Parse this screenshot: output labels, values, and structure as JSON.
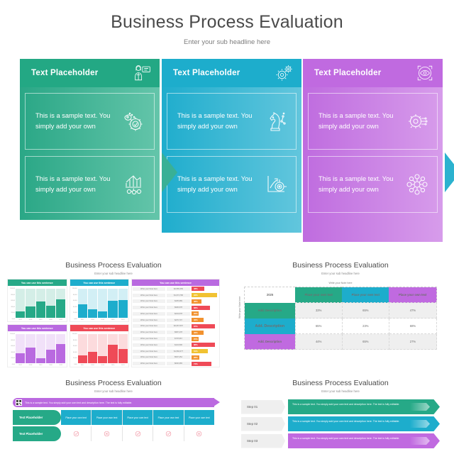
{
  "hero": {
    "title": "Business Process Evaluation",
    "subtitle": "Enter your sub headline here",
    "colors": {
      "green": "#23a884",
      "blue": "#1dadcc",
      "purple": "#c06ae0"
    },
    "panels": [
      {
        "header_label": "Text Placeholder",
        "header_icon": "presenter-icon",
        "cells": [
          {
            "text": "This is a sample text. You simply add your own",
            "icon": "rocket-gear-icon"
          },
          {
            "text": "This is a sample text. You simply add your own",
            "icon": "bar-chart-network-icon"
          }
        ]
      },
      {
        "header_label": "Text Placeholder",
        "header_icon": "gears-icon",
        "cells": [
          {
            "text": "This is a sample text. You simply add your own",
            "icon": "chess-knight-icon"
          },
          {
            "text": "This is a sample text. You simply add your own",
            "icon": "target-growth-icon"
          }
        ]
      },
      {
        "header_label": "Text Placeholder",
        "header_icon": "eye-vision-icon",
        "cells": [
          {
            "text": "This is a sample text. You simply add your own",
            "icon": "gear-circuit-icon"
          },
          {
            "text": "This is a sample text. You simply add your own",
            "icon": "network-nodes-icon"
          }
        ]
      }
    ]
  },
  "thumbs": [
    {
      "id": "charts-and-list",
      "title": "Business Process Evaluation",
      "subtitle": "Enter your sub headline here",
      "charts": [
        {
          "header": "You can use this sentence",
          "color": "#26a987"
        },
        {
          "header": "You can use this sentence",
          "color": "#1dadcc"
        },
        {
          "header": "You can use this sentence",
          "color": "#b96ae0"
        },
        {
          "header": "You can use this sentence",
          "color": "#ef4a57"
        }
      ],
      "list": {
        "header": "You can use this sentence",
        "rows": [
          {
            "note": "Write your Note here",
            "value": "$2,565,456",
            "pct": "48%"
          },
          {
            "note": "Write your Note here",
            "value": "$1,674,786",
            "pct": "94%"
          },
          {
            "note": "Write your Note here",
            "value": "$435,989",
            "pct": "38%"
          },
          {
            "note": "Write your Note here",
            "value": "$906,678",
            "pct": "68%"
          },
          {
            "note": "Write your Note here",
            "value": "$234,678",
            "pct": "26%"
          },
          {
            "note": "Write your Note here",
            "value": "$276,707",
            "pct": "46%"
          },
          {
            "note": "Write your Note here",
            "value": "$2,067,567",
            "pct": "87%"
          },
          {
            "note": "Write your Note here",
            "value": "$987,478",
            "pct": "46%"
          },
          {
            "note": "Write your Note here",
            "value": "$778,967",
            "pct": "25%"
          },
          {
            "note": "Write your Note here",
            "value": "$143,596",
            "pct": "88%"
          },
          {
            "note": "Write your Note here",
            "value": "$1,566,677",
            "pct": "61%"
          },
          {
            "note": "Write your Note here",
            "value": "$597,454",
            "pct": "28%"
          },
          {
            "note": "Write your Note here",
            "value": "$646,365",
            "pct": "74%"
          }
        ]
      }
    },
    {
      "id": "matrix-table",
      "title": "Business Process Evaluation",
      "subtitle": "Enter your sub headline here",
      "top_note": "Write your Note here",
      "side_note": "Write your Note here",
      "year": "2025",
      "columns": [
        "Place your own text",
        "Place your own text",
        "Place your own text"
      ],
      "rows": [
        {
          "label": "Add. Description",
          "color": "#26a987",
          "values": [
            "33%",
            "65%",
            "47%"
          ]
        },
        {
          "label": "Add. Description",
          "color": "#1dadcc",
          "values": [
            "65%",
            "23%",
            "68%"
          ]
        },
        {
          "label": "Add. Description",
          "color": "#c06ae0",
          "values": [
            "44%",
            "65%",
            "27%"
          ]
        }
      ]
    },
    {
      "id": "checklist-grid",
      "title": "Business Process Evaluation",
      "subtitle": "Enter your sub headline here",
      "banner": "This is a sample text. You simply add your own text and description here. The text is fully editable.",
      "banner_icon": "qr-code-icon",
      "rows": [
        {
          "label": "Text Placeholder",
          "cells": [
            "Place your own text",
            "Place your own text",
            "Place your own text",
            "Place your own text",
            "Place your own text"
          ],
          "type": "header"
        },
        {
          "label": "Text Placeholder",
          "cells": [
            "check-icon",
            "cross-icon",
            "check-icon",
            "check-icon",
            "cross-icon"
          ],
          "type": "icons"
        }
      ]
    },
    {
      "id": "steps-arrows",
      "title": "Business Process Evaluation",
      "subtitle": "Enter your sub headline here",
      "steps": [
        {
          "step": "Step 01",
          "text": "This is a sample text. You simply add your own text and description here. The text is fully editable.",
          "color": "#26a987"
        },
        {
          "step": "Step 02",
          "text": "This is a sample text. You simply add your own text and description here. The text is fully editable.",
          "color": "#1dadcc"
        },
        {
          "step": "Step 03",
          "text": "This is a sample text. You simply add your own text and description here. The text is fully editable.",
          "color": "#c06ae0"
        }
      ]
    }
  ],
  "chart_data": [
    {
      "type": "bar",
      "title": "You can use this sentence",
      "categories": [
        "2017",
        "2018",
        "2019",
        "2020",
        "2021"
      ],
      "values": [
        30,
        52,
        78,
        58,
        88
      ],
      "ylim": [
        0,
        100
      ],
      "color": "#26a987",
      "ylabel": "",
      "xlabel": ""
    },
    {
      "type": "bar",
      "title": "You can use this sentence",
      "categories": [
        "2017",
        "2018",
        "2019",
        "2020",
        "2021"
      ],
      "values": [
        62,
        40,
        30,
        80,
        85
      ],
      "ylim": [
        0,
        100
      ],
      "color": "#1dadcc",
      "ylabel": "",
      "xlabel": ""
    },
    {
      "type": "bar",
      "title": "You can use this sentence",
      "categories": [
        "2017",
        "2018",
        "2019",
        "2020",
        "2021"
      ],
      "values": [
        48,
        75,
        25,
        62,
        90
      ],
      "ylim": [
        0,
        100
      ],
      "color": "#b96ae0",
      "ylabel": "",
      "xlabel": ""
    },
    {
      "type": "bar",
      "title": "You can use this sentence",
      "categories": [
        "2017",
        "2018",
        "2019",
        "2020",
        "2021"
      ],
      "values": [
        38,
        55,
        35,
        88,
        68
      ],
      "ylim": [
        0,
        100
      ],
      "color": "#ef4a57",
      "ylabel": "",
      "xlabel": ""
    }
  ]
}
